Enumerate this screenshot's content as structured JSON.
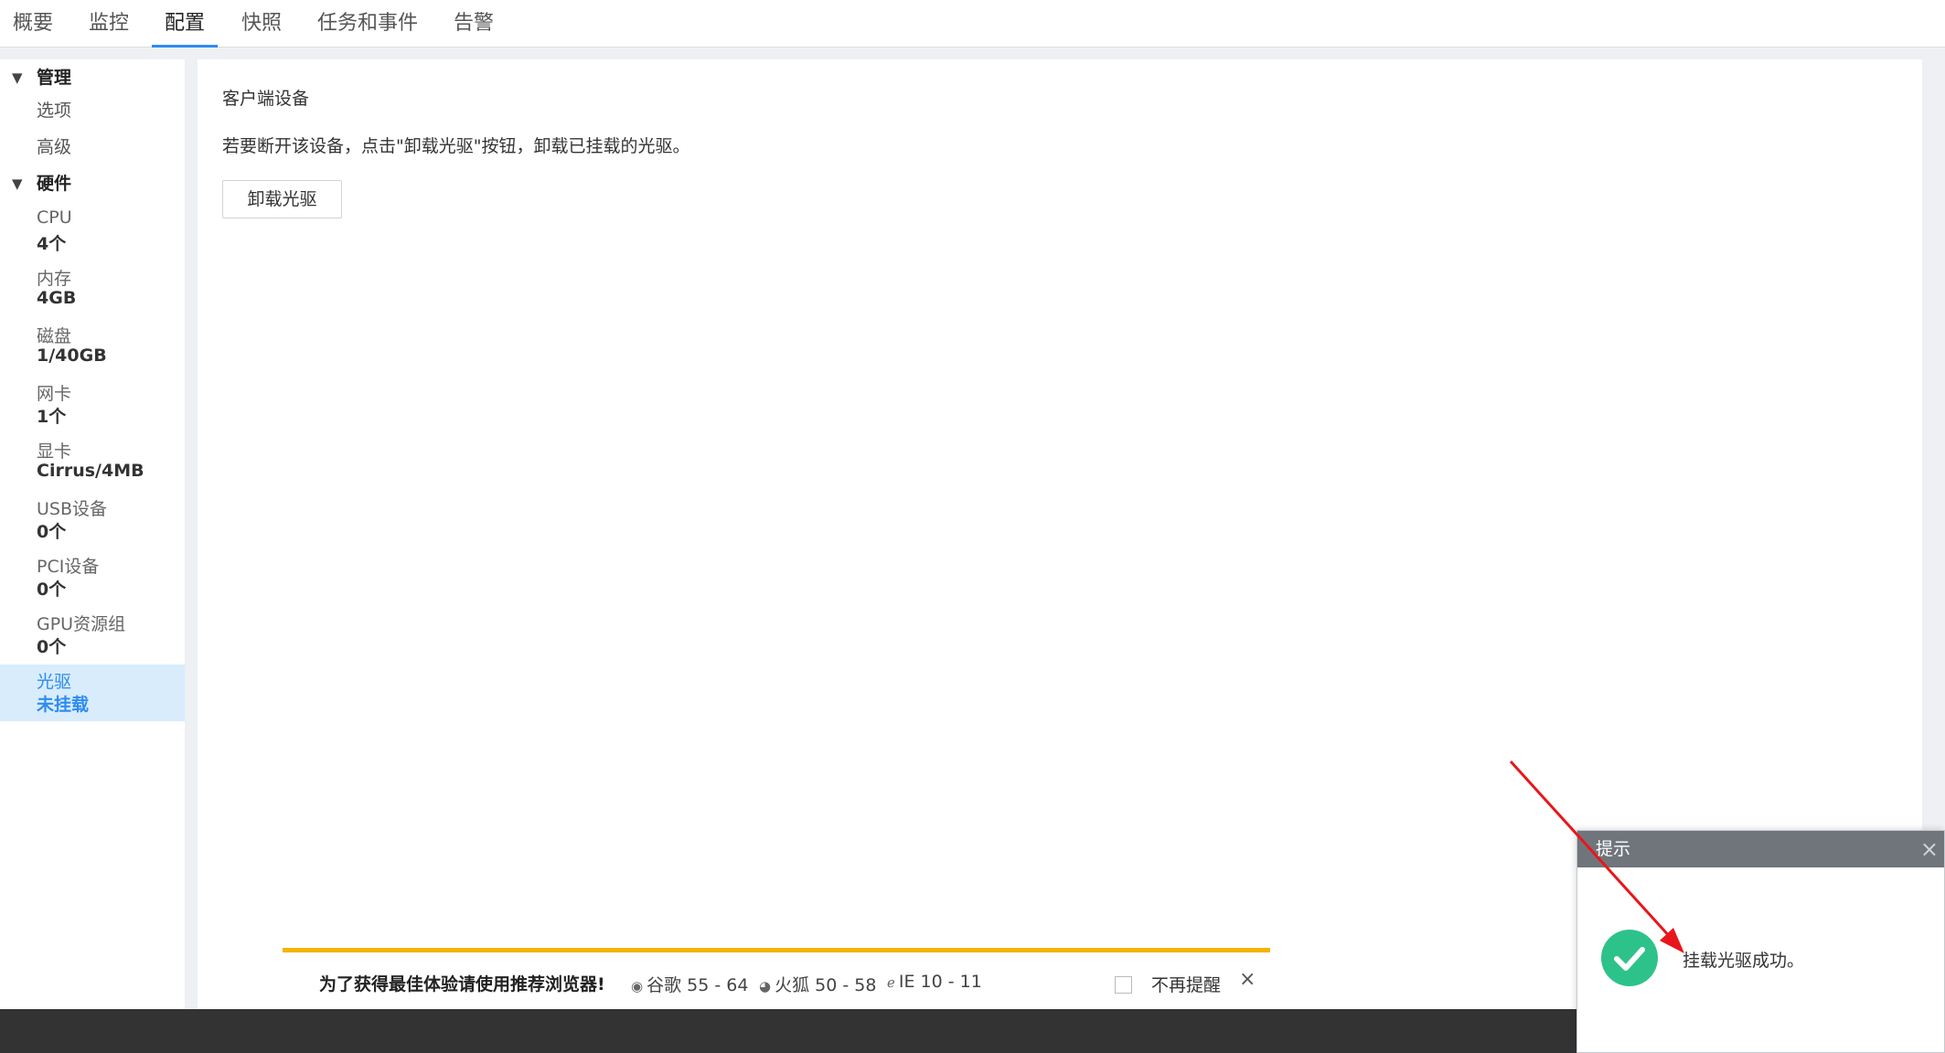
{
  "tabs": [
    {
      "label": "概要"
    },
    {
      "label": "监控"
    },
    {
      "label": "配置"
    },
    {
      "label": "快照"
    },
    {
      "label": "任务和事件"
    },
    {
      "label": "告警"
    }
  ],
  "active_tab": "配置",
  "sidebar": {
    "management": {
      "label": "管理",
      "items": [
        {
          "label": "选项"
        },
        {
          "label": "高级"
        }
      ]
    },
    "hardware": {
      "label": "硬件",
      "items": [
        {
          "label": "CPU",
          "value": "4个"
        },
        {
          "label": "内存",
          "value": "4GB"
        },
        {
          "label": "磁盘",
          "value": "1/40GB"
        },
        {
          "label": "网卡",
          "value": "1个"
        },
        {
          "label": "显卡",
          "value": "Cirrus/4MB"
        },
        {
          "label": "USB设备",
          "value": "0个"
        },
        {
          "label": "PCI设备",
          "value": "0个"
        },
        {
          "label": "GPU资源组",
          "value": "0个"
        },
        {
          "label": "光驱",
          "value": "未挂载"
        }
      ],
      "selected": "光驱"
    }
  },
  "main": {
    "section_title": "客户端设备",
    "description": "若要断开该设备，点击\"卸载光驱\"按钮，卸载已挂载的光驱。",
    "button_label": "卸载光驱"
  },
  "banner": {
    "message": "为了获得最佳体验请使用推荐浏览器!",
    "browsers": [
      {
        "name": "谷歌 55 - 64",
        "icon": "chrome-icon"
      },
      {
        "name": "火狐 50 - 58",
        "icon": "firefox-icon"
      },
      {
        "name": "IE 10 - 11",
        "icon": "ie-icon"
      }
    ],
    "no_remind_label": "不再提醒"
  },
  "dialog": {
    "title": "提示",
    "message": "挂载光驱成功。",
    "icon": "success-check-icon"
  },
  "colors": {
    "accent": "#2d8cf0",
    "success": "#2ec28b",
    "banner_border": "#f5b400",
    "arrow": "#e8161b",
    "footer": "#333333"
  }
}
